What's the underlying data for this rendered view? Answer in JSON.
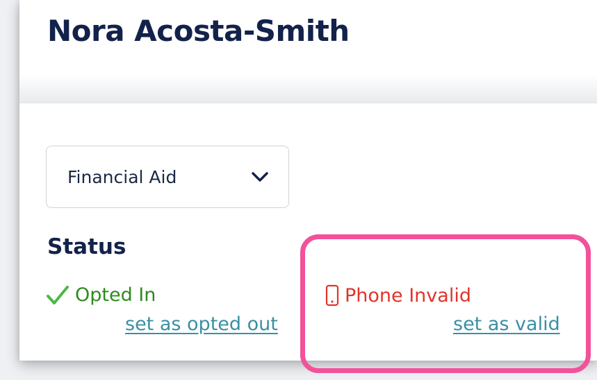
{
  "contact": {
    "name": "Nora Acosta-Smith"
  },
  "department_select": {
    "selected": "Financial Aid"
  },
  "status": {
    "heading": "Status",
    "opt_in": {
      "label": "Opted In",
      "action": "set as opted out",
      "color": "#2f8a1e"
    },
    "phone": {
      "label": "Phone Invalid",
      "action": "set as valid",
      "color": "#e0342a"
    }
  },
  "icons": {
    "dropdown": "chevron-down-icon",
    "opt_in": "check-icon",
    "phone": "phone-icon"
  },
  "colors": {
    "heading": "#13224a",
    "link": "#3a8fa6",
    "highlight": "#f2519b"
  }
}
